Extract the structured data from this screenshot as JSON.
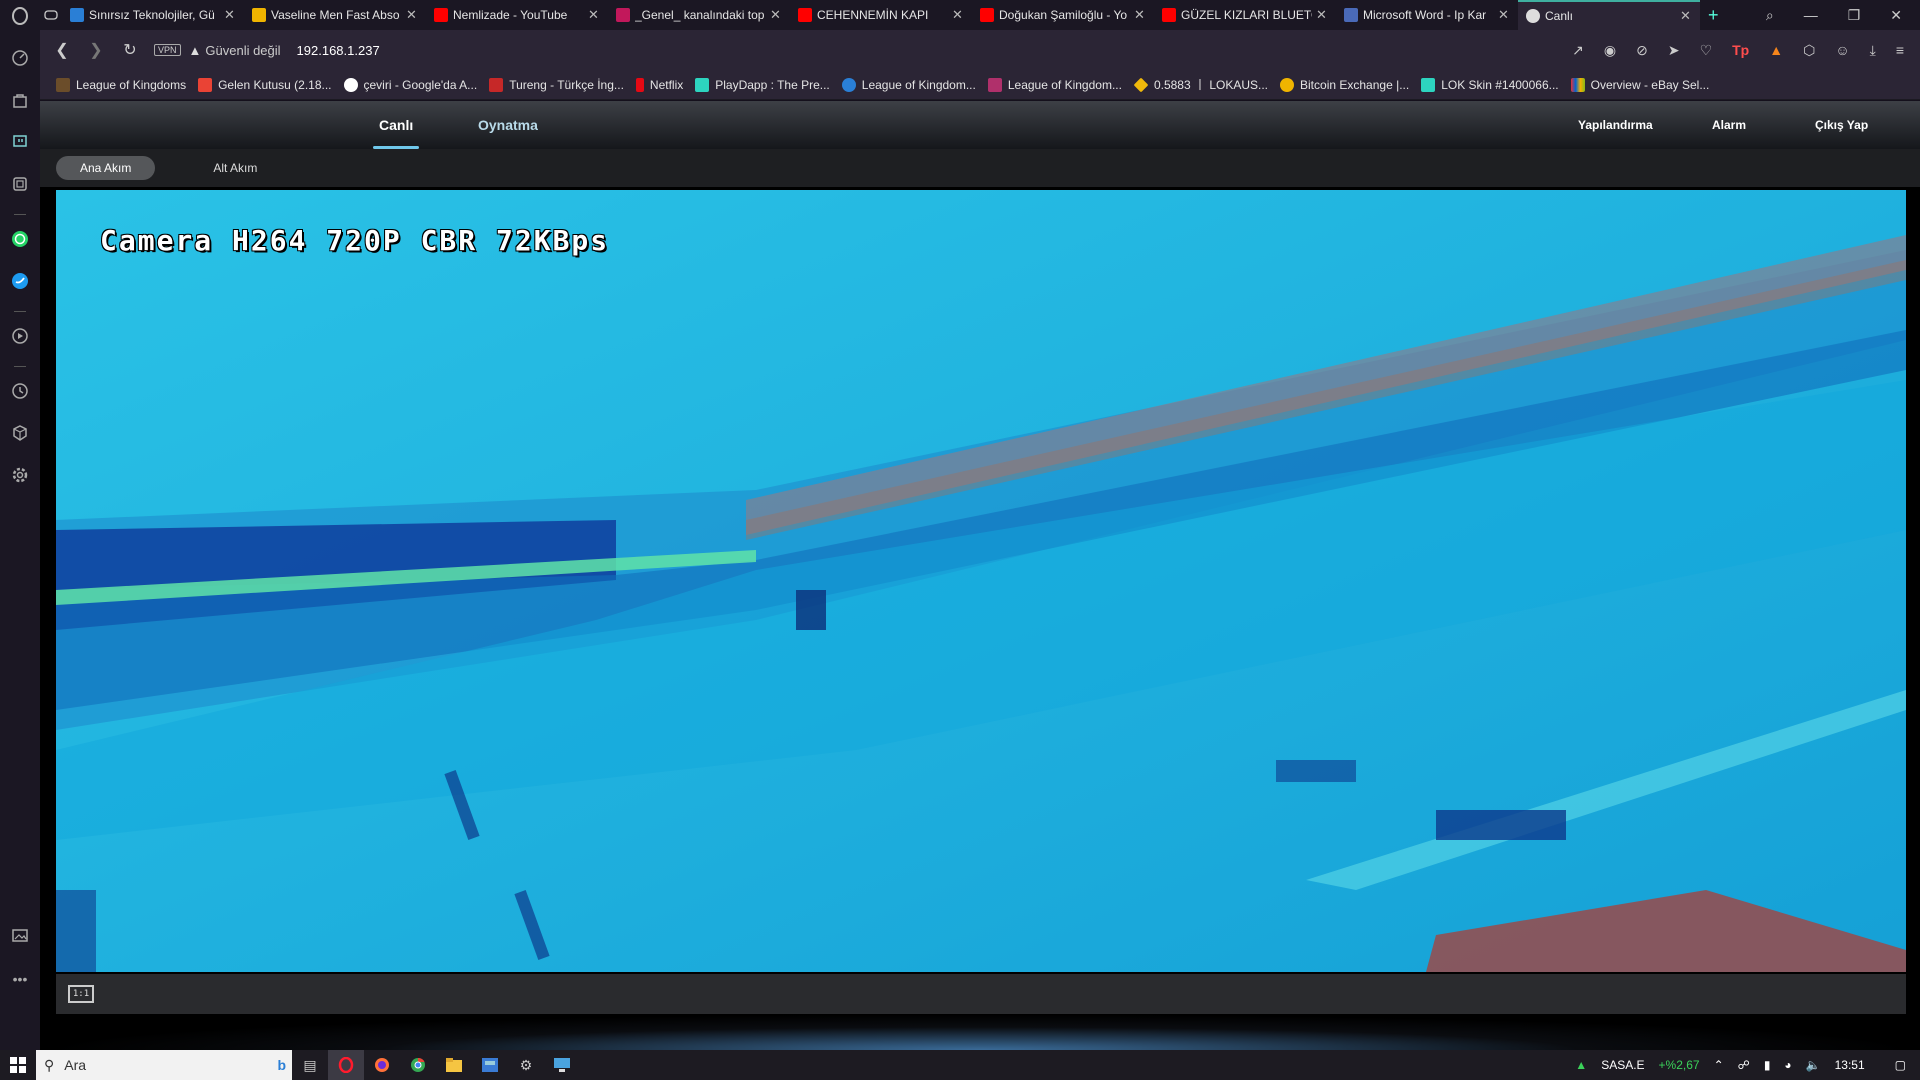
{
  "browser": {
    "tabs": [
      {
        "title": "Sınırsız Teknolojiler, Gü",
        "color": "#2a7fd6"
      },
      {
        "title": "Vaseline Men Fast Abso",
        "color": "#f0b400"
      },
      {
        "title": "Nemlizade - YouTube",
        "color": "#ff0000"
      },
      {
        "title": "_Genel_ kanalındaki top",
        "color": "#c2185b"
      },
      {
        "title": "CEHENNEMİN KAPI",
        "color": "#ff0000"
      },
      {
        "title": "Doğukan Şamiloğlu - Yo",
        "color": "#ff0000"
      },
      {
        "title": "GÜZEL KIZLARI BLUETO",
        "color": "#ff0000"
      },
      {
        "title": "Microsoft Word - Ip Kar",
        "color": "#4a6ab8"
      },
      {
        "title": "Canlı",
        "color": "#dddddd",
        "active": true
      }
    ],
    "address": {
      "vpn": "VPN",
      "security": "Güvenli değil",
      "url": "192.168.1.237"
    },
    "bookmarks": [
      {
        "label": "League of Kingdoms",
        "color": "#6b4d2a"
      },
      {
        "label": "Gelen Kutusu (2.18...",
        "color": "#ea4335"
      },
      {
        "label": "çeviri - Google'da A...",
        "color": "#ffffff"
      },
      {
        "label": "Tureng - Türkçe İng...",
        "color": "#c62828"
      },
      {
        "label": "Netflix",
        "color": "#e50914"
      },
      {
        "label": "PlayDapp : The Pre...",
        "color": "#2dd4bf"
      },
      {
        "label": "League of Kingdom...",
        "color": "#2a7fd6"
      },
      {
        "label": "League of Kingdom...",
        "color": "#b0306b"
      },
      {
        "label": "0.5883 丨 LOKAUS...",
        "color": "#f0b90b"
      },
      {
        "label": "Bitcoin Exchange |...",
        "color": "#f0b400"
      },
      {
        "label": "LOK Skin #1400066...",
        "color": "#2dd4bf"
      },
      {
        "label": "Overview - eBay Sel...",
        "color": "#e53238"
      }
    ]
  },
  "camera": {
    "nav": {
      "live": "Canlı",
      "playback": "Oynatma",
      "config": "Yapılandırma",
      "alarm": "Alarm",
      "logout": "Çıkış Yap"
    },
    "streams": {
      "main": "Ana Akım",
      "sub": "Alt Akım"
    },
    "osd": "Camera H264 720P CBR 72KBps",
    "ratio_button": "1:1"
  },
  "taskbar": {
    "search_placeholder": "Ara",
    "stock_symbol": "SASA.E",
    "stock_change": "+%2,67",
    "clock": "13:51"
  }
}
